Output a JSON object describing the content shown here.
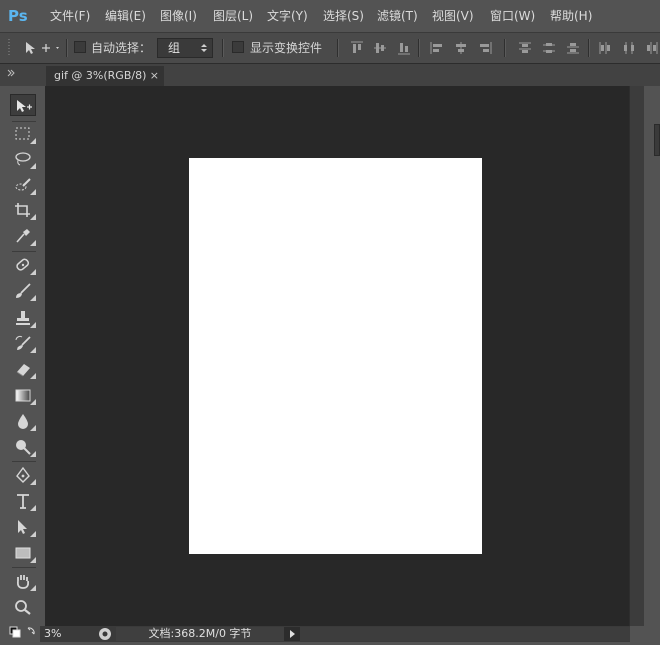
{
  "app": {
    "logo": "Ps"
  },
  "menu": [
    "文件(F)",
    "编辑(E)",
    "图像(I)",
    "图层(L)",
    "文字(Y)",
    "选择(S)",
    "滤镜(T)",
    "视图(V)",
    "窗口(W)",
    "帮助(H)"
  ],
  "options": {
    "auto_select_label": "自动选择：",
    "auto_select_value": "组",
    "show_transform_label": "显示变换控件"
  },
  "document": {
    "tab_title": "gif @ 3%(RGB/8)",
    "close_glyph": "×"
  },
  "status": {
    "zoom": "3%",
    "doc_info": "文档:368.2M/0 字节"
  },
  "icons": {
    "move": "move-icon",
    "marquee": "rect-marquee-icon",
    "lasso": "lasso-icon",
    "quick_select": "quick-select-icon",
    "crop": "crop-icon",
    "eyedropper": "eyedropper-icon",
    "healing": "healing-brush-icon",
    "brush": "brush-icon",
    "stamp": "clone-stamp-icon",
    "history_brush": "history-brush-icon",
    "eraser": "eraser-icon",
    "gradient": "gradient-icon",
    "blur": "blur-icon",
    "dodge": "dodge-icon",
    "pen": "pen-icon",
    "type": "type-icon",
    "path_select": "path-select-icon",
    "shape": "rectangle-shape-icon",
    "hand": "hand-icon",
    "zoom": "zoom-icon"
  },
  "colors": {
    "accent": "#5bb6f0",
    "workspace": "#282828",
    "ui": "#535353"
  }
}
